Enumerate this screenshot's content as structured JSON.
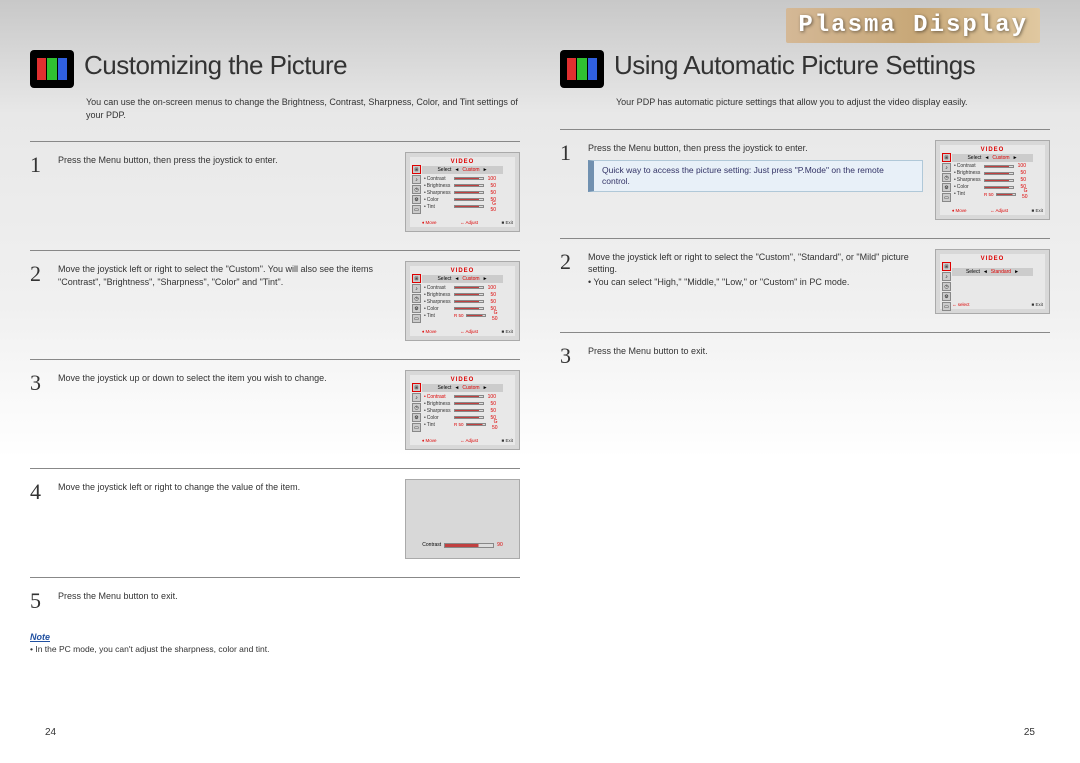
{
  "banner": {
    "title": "Plasma Display"
  },
  "page_left_num": "24",
  "page_right_num": "25",
  "left": {
    "title": "Customizing the Picture",
    "desc": "You can use the on-screen menus to change the Brightness, Contrast, Sharpness, Color, and Tint settings of your PDP.",
    "steps": [
      {
        "num": "1",
        "text": "Press the Menu button, then press the joystick to enter."
      },
      {
        "num": "2",
        "text": "Move the joystick left or right to select the \"Custom\". You will also see the items \"Contrast\", \"Brightness\", \"Sharpness\", \"Color\" and \"Tint\"."
      },
      {
        "num": "3",
        "text": "Move the joystick up or down to select the item you wish to change."
      },
      {
        "num": "4",
        "text": "Move the joystick left or right to change the value of the item."
      },
      {
        "num": "5",
        "text": "Press the Menu button to exit."
      }
    ],
    "note_label": "Note",
    "note_text": "• In the PC mode, you can't adjust the sharpness, color and tint."
  },
  "right": {
    "title": "Using Automatic Picture Settings",
    "desc": "Your PDP has automatic picture settings that allow you to adjust the video display easily.",
    "steps": [
      {
        "num": "1",
        "text": "Press the Menu button, then press the joystick to enter.",
        "tip": "Quick way to access the picture setting: Just press \"P.Mode\" on the remote control."
      },
      {
        "num": "2",
        "text": "Move the joystick left or right to select the \"Custom\", \"Standard\", or \"Mild\" picture setting.\n• You can select \"High,\" \"Middle,\" \"Low,\" or \"Custom\" in PC mode."
      },
      {
        "num": "3",
        "text": "Press the Menu button to exit."
      }
    ]
  },
  "osd": {
    "title": "VIDEO",
    "select_label": "Select",
    "mode_custom": "Custom",
    "mode_standard": "Standard",
    "items": [
      {
        "label": "Contrast",
        "val": "100"
      },
      {
        "label": "Brightness",
        "val": "50"
      },
      {
        "label": "Sharpness",
        "val": "50"
      },
      {
        "label": "Color",
        "val": "50"
      },
      {
        "label": "Tint",
        "val_prefix": "R 50",
        "val": "G 50"
      }
    ],
    "footer_move": "Move",
    "footer_adjust": "Adjust",
    "footer_select": "select",
    "footer_exit": "Exit",
    "single_label": "Contrast",
    "single_val": "90"
  }
}
